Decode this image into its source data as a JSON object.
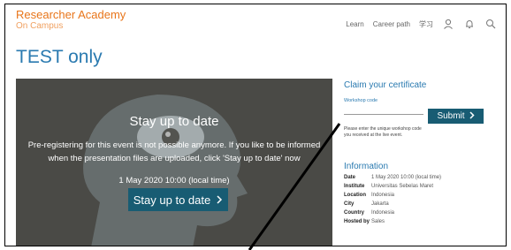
{
  "brand": {
    "name": "Researcher Academy",
    "subtitle": "On Campus"
  },
  "nav": {
    "items": [
      "Learn",
      "Career path",
      "学习"
    ]
  },
  "page": {
    "title": "TEST only"
  },
  "hero": {
    "heading": "Stay up to date",
    "message": "Pre-registering for this event is not possible anymore. If you like to be informed when the presentation files are uploaded, click 'Stay up to date' now",
    "datetime": "1 May 2020 10:00 (local time)",
    "button_label": "Stay up to date"
  },
  "claim": {
    "title": "Claim your certificate",
    "code_label": "Workshop code",
    "submit_label": "Submit",
    "note": "Please enter the unique workshop code you received at the live event."
  },
  "info": {
    "title": "Information",
    "rows": [
      {
        "label": "Date",
        "value": "1 May 2020 10:00 (local time)"
      },
      {
        "label": "Institute",
        "value": "Universitas Sebelas Maret"
      },
      {
        "label": "Location",
        "value": "Indonesia"
      },
      {
        "label": "City",
        "value": "Jakarta"
      },
      {
        "label": "Country",
        "value": "Indonesia"
      },
      {
        "label": "Hosted by",
        "value": "Sales"
      }
    ]
  },
  "colors": {
    "brand_orange": "#e8751a",
    "link_blue": "#2a7ab0",
    "button_teal": "#185c73",
    "hero_bg": "#4a4a46"
  }
}
